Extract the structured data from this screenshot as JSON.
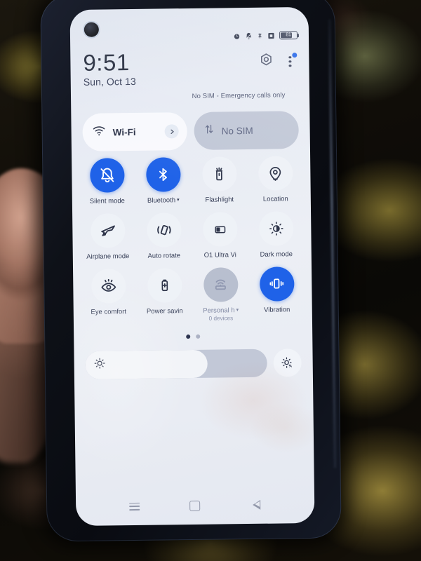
{
  "device": {
    "kind": "smartphone-photo",
    "screen_panel": "quick-settings"
  },
  "statusbar": {
    "icons": [
      "alarm-icon",
      "notification-muted-icon",
      "bluetooth-icon",
      "sdcard-icon"
    ],
    "battery_percent": "81",
    "battery_fill_pct": 72
  },
  "header": {
    "time": "9:51",
    "date": "Sun, Oct 13",
    "carrier_status": "No SIM - Emergency calls only",
    "settings_icon": "gear-icon",
    "overflow_icon": "three-dot-menu-icon",
    "overflow_badge": true
  },
  "connectivity": {
    "wifi": {
      "label": "Wi-Fi",
      "icon": "wifi-icon",
      "state": "light",
      "chevron": "chevron-right-icon"
    },
    "sim": {
      "label": "No SIM",
      "icon": "data-transfer-icon",
      "state": "dim"
    }
  },
  "tiles": [
    {
      "label": "Silent mode",
      "icon": "bell-off-icon",
      "state": "on",
      "caret": false,
      "sub": ""
    },
    {
      "label": "Bluetooth",
      "icon": "bluetooth-icon",
      "state": "on",
      "caret": true,
      "sub": ""
    },
    {
      "label": "Flashlight",
      "icon": "flashlight-icon",
      "state": "off",
      "caret": false,
      "sub": ""
    },
    {
      "label": "Location",
      "icon": "location-pin-icon",
      "state": "off",
      "caret": false,
      "sub": ""
    },
    {
      "label": "Airplane mode",
      "icon": "airplane-icon",
      "state": "off",
      "caret": false,
      "sub": ""
    },
    {
      "label": "Auto rotate",
      "icon": "auto-rotate-icon",
      "state": "off",
      "caret": false,
      "sub": ""
    },
    {
      "label": "O1 Ultra Vi",
      "icon": "ultra-vision-icon",
      "state": "off",
      "caret": false,
      "sub": ""
    },
    {
      "label": "Dark mode",
      "icon": "dark-mode-icon",
      "state": "off",
      "caret": false,
      "sub": ""
    },
    {
      "label": "Eye comfort",
      "icon": "eye-comfort-icon",
      "state": "off",
      "caret": false,
      "sub": ""
    },
    {
      "label": "Power savin",
      "icon": "battery-saver-icon",
      "state": "off",
      "caret": false,
      "sub": ""
    },
    {
      "label": "Personal h",
      "icon": "hotspot-icon",
      "state": "muted",
      "caret": true,
      "sub": "0 devices"
    },
    {
      "label": "Vibration",
      "icon": "vibration-icon",
      "state": "on",
      "caret": false,
      "sub": ""
    }
  ],
  "pager": {
    "count": 2,
    "active": 0
  },
  "brightness": {
    "value_pct": 67,
    "slider_icon": "brightness-icon",
    "auto_icon": "brightness-auto-icon"
  },
  "navbar": {
    "recents_icon": "recents-menu-icon",
    "home_icon": "home-square-icon",
    "back_icon": "back-triangle-icon"
  },
  "colors": {
    "accent_blue": "#1f62e8",
    "screen_bg": "#eceff5",
    "text_primary": "#242b3d",
    "text_secondary": "#4c5470",
    "bezel": "#0e1118"
  }
}
